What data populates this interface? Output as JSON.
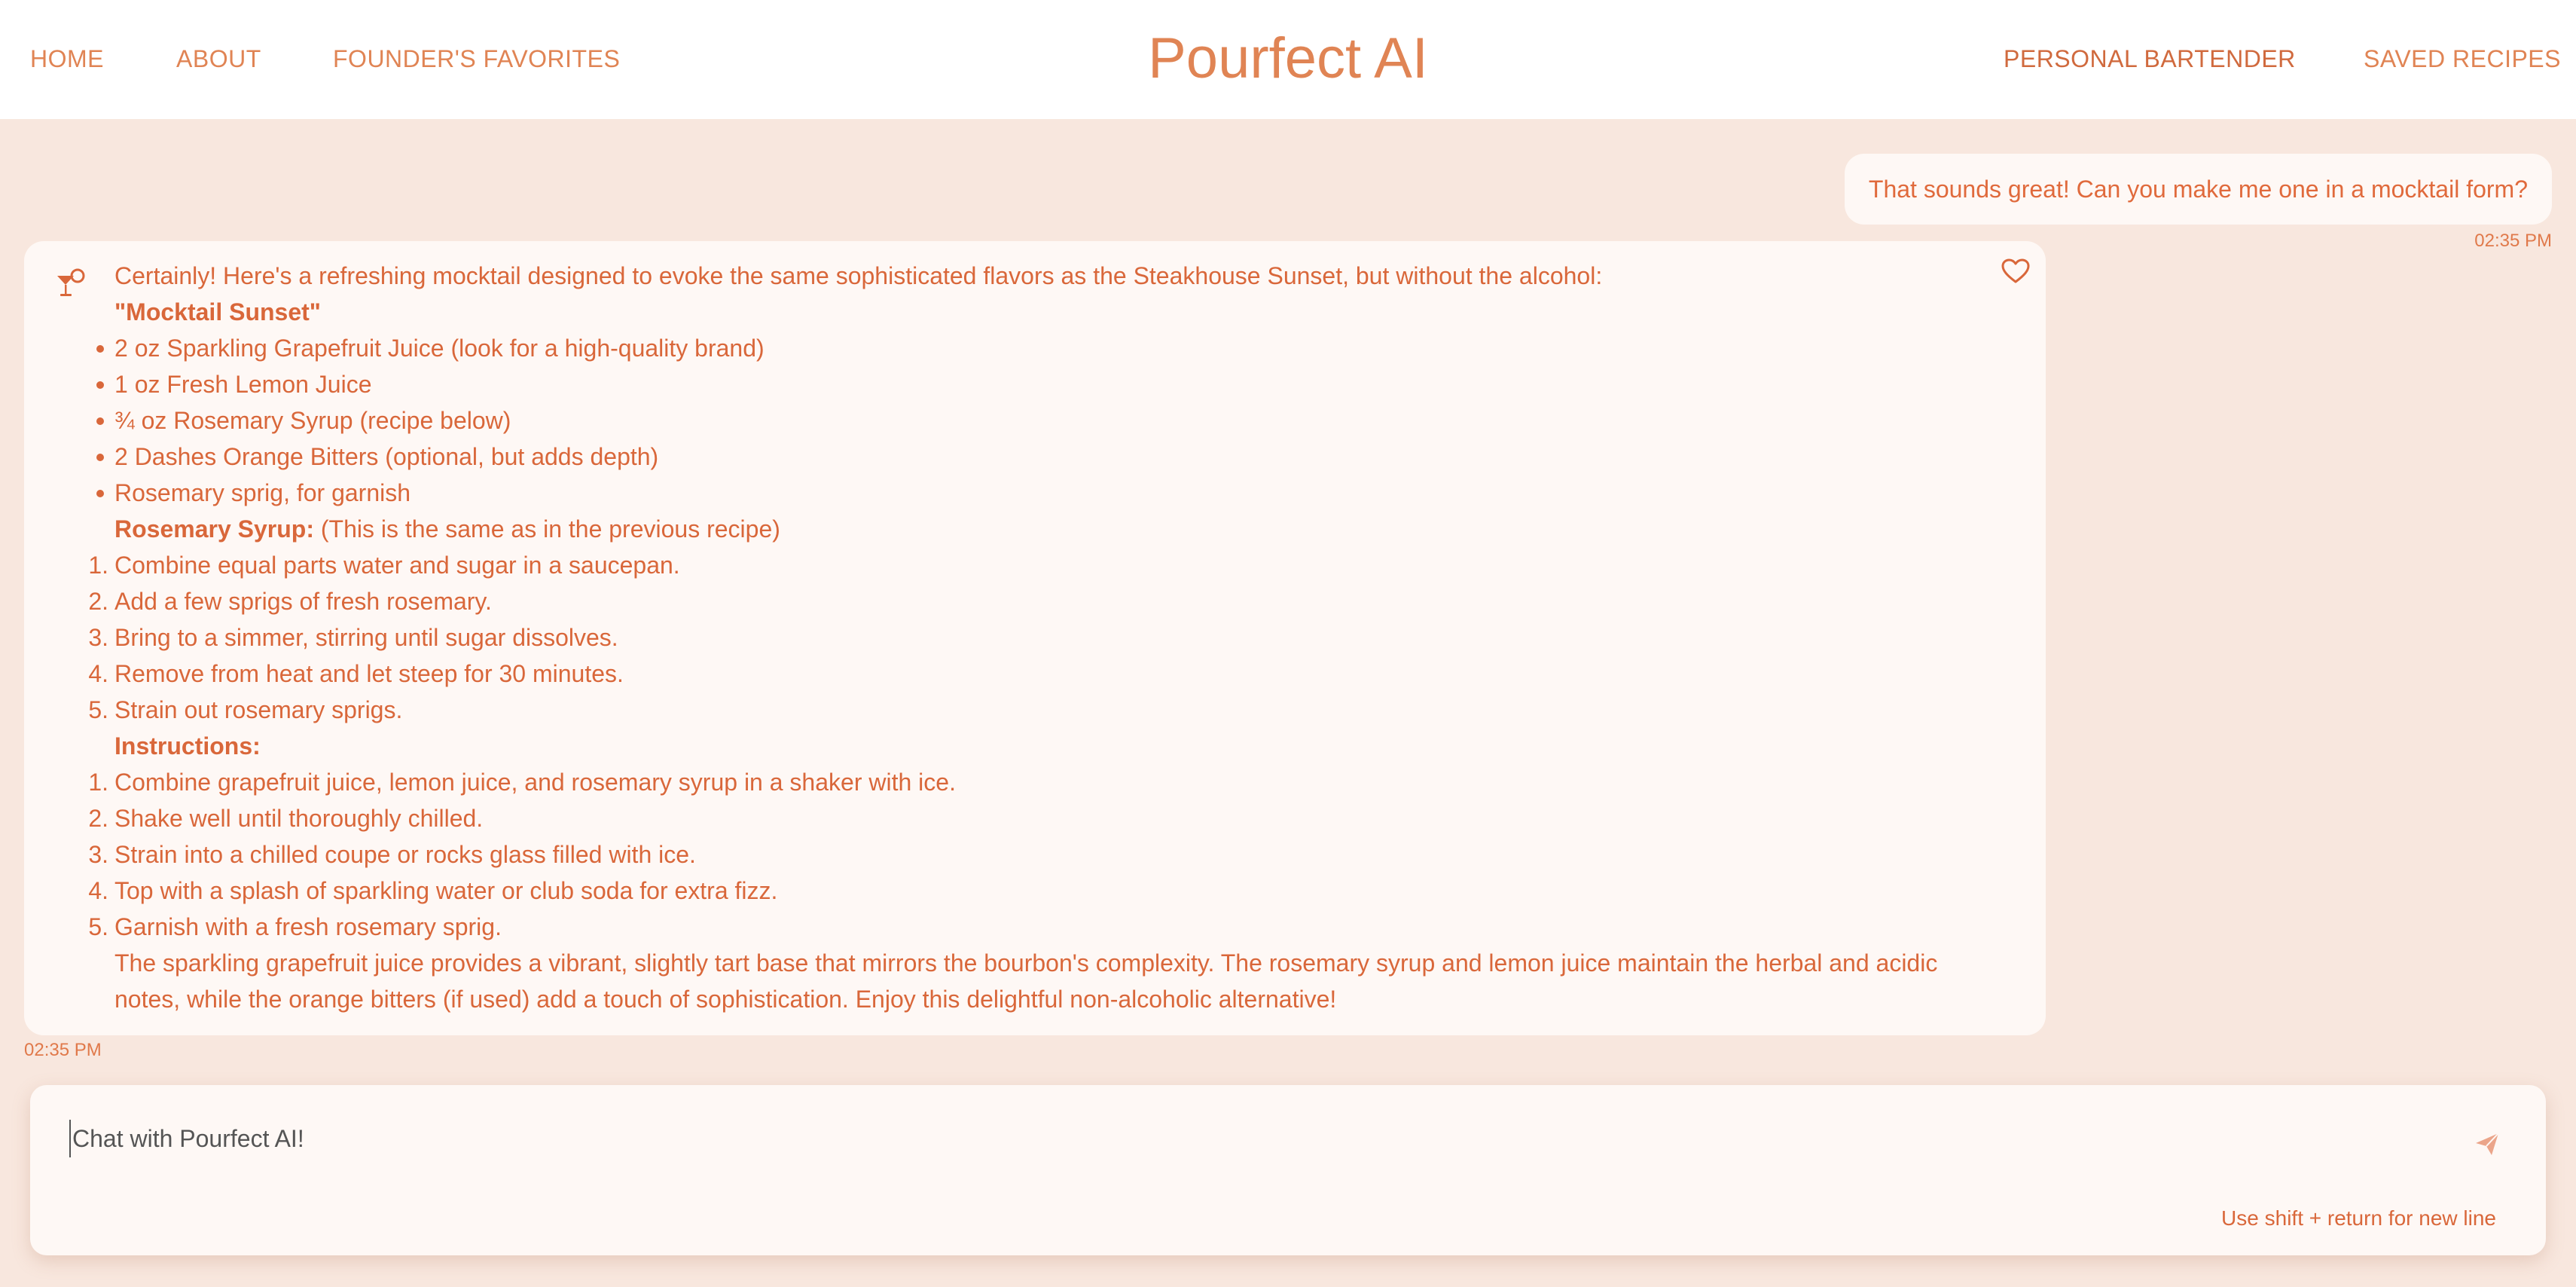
{
  "nav": {
    "home": "HOME",
    "about": "ABOUT",
    "founders": "FOUNDER'S FAVORITES",
    "brand": "Pourfect AI",
    "bartender": "PERSONAL BARTENDER",
    "saved": "SAVED RECIPES"
  },
  "user_message": {
    "text": "That sounds great! Can you make me one in a mocktail form?",
    "time": "02:35 PM"
  },
  "bot_message": {
    "icon": "cocktail-icon",
    "favorite_icon": "heart-icon",
    "intro": "Certainly! Here's a refreshing mocktail designed to evoke the same sophisticated flavors as the Steakhouse Sunset, but without the alcohol:",
    "recipe_name": "\"Mocktail Sunset\"",
    "ingredients": [
      "2 oz Sparkling Grapefruit Juice (look for a high-quality brand)",
      "1 oz Fresh Lemon Juice",
      "¾ oz Rosemary Syrup (recipe below)",
      "2 Dashes Orange Bitters (optional, but adds depth)",
      "Rosemary sprig, for garnish"
    ],
    "syrup_heading": "Rosemary Syrup:",
    "syrup_note": "(This is the same as in the previous recipe)",
    "syrup_steps": [
      "Combine equal parts water and sugar in a saucepan.",
      "Add a few sprigs of fresh rosemary.",
      "Bring to a simmer, stirring until sugar dissolves.",
      "Remove from heat and let steep for 30 minutes.",
      "Strain out rosemary sprigs."
    ],
    "instructions_heading": "Instructions:",
    "instructions": [
      "Combine grapefruit juice, lemon juice, and rosemary syrup in a shaker with ice.",
      "Shake well until thoroughly chilled.",
      "Strain into a chilled coupe or rocks glass filled with ice.",
      "Top with a splash of sparkling water or club soda for extra fizz.",
      "Garnish with a fresh rosemary sprig."
    ],
    "closing": "The sparkling grapefruit juice provides a vibrant, slightly tart base that mirrors the bourbon's complexity. The rosemary syrup and lemon juice maintain the herbal and acidic notes, while the orange bitters (if used) add a touch of sophistication. Enjoy this delightful non-alcoholic alternative!",
    "time": "02:35 PM"
  },
  "input": {
    "placeholder": "Chat with Pourfect AI!",
    "value": "",
    "hint": "Use shift + return for new line",
    "send_icon": "send-icon"
  },
  "colors": {
    "accent": "#d9673a",
    "background": "#f8e7de",
    "card": "#fef8f5"
  }
}
